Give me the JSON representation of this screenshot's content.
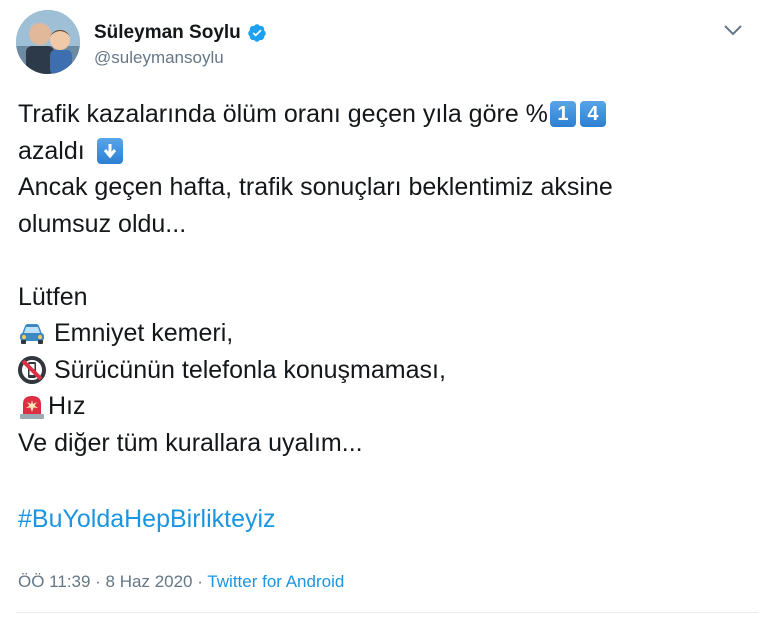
{
  "author": {
    "name": "Süleyman Soylu",
    "handle": "@sulеymansoylu"
  },
  "tweet": {
    "line1": "Trafik kazalarında ölüm oranı geçen yıla göre %",
    "digit1": "1",
    "digit2": "4",
    "line2": "azaldı",
    "line3": "Ancak geçen hafta, trafik sonuçları beklentimiz aksine",
    "line4": "olumsuz oldu...",
    "line5": "Lütfen",
    "line6": "Emniyet kemeri,",
    "line7": "Sürücünün telefonla konuşmaması,",
    "line8": "Hız",
    "line9": "Ve diğer tüm kurallara uyalım...",
    "hashtag": "#BuYoldaHepBirlikteyiz"
  },
  "meta": {
    "time": "ÖÖ 11:39 · 8 Haz 2020 · ",
    "source": "Twitter for Android"
  },
  "icons": {
    "verified": "verified-badge-icon",
    "caret": "chevron-down-icon",
    "down_arrow": "down-arrow-emoji",
    "car": "car-emoji",
    "no_phone": "no-mobile-phones-emoji",
    "siren": "police-light-emoji"
  },
  "colors": {
    "link": "#1b95e0",
    "text": "#14171a",
    "secondary": "#657786"
  }
}
